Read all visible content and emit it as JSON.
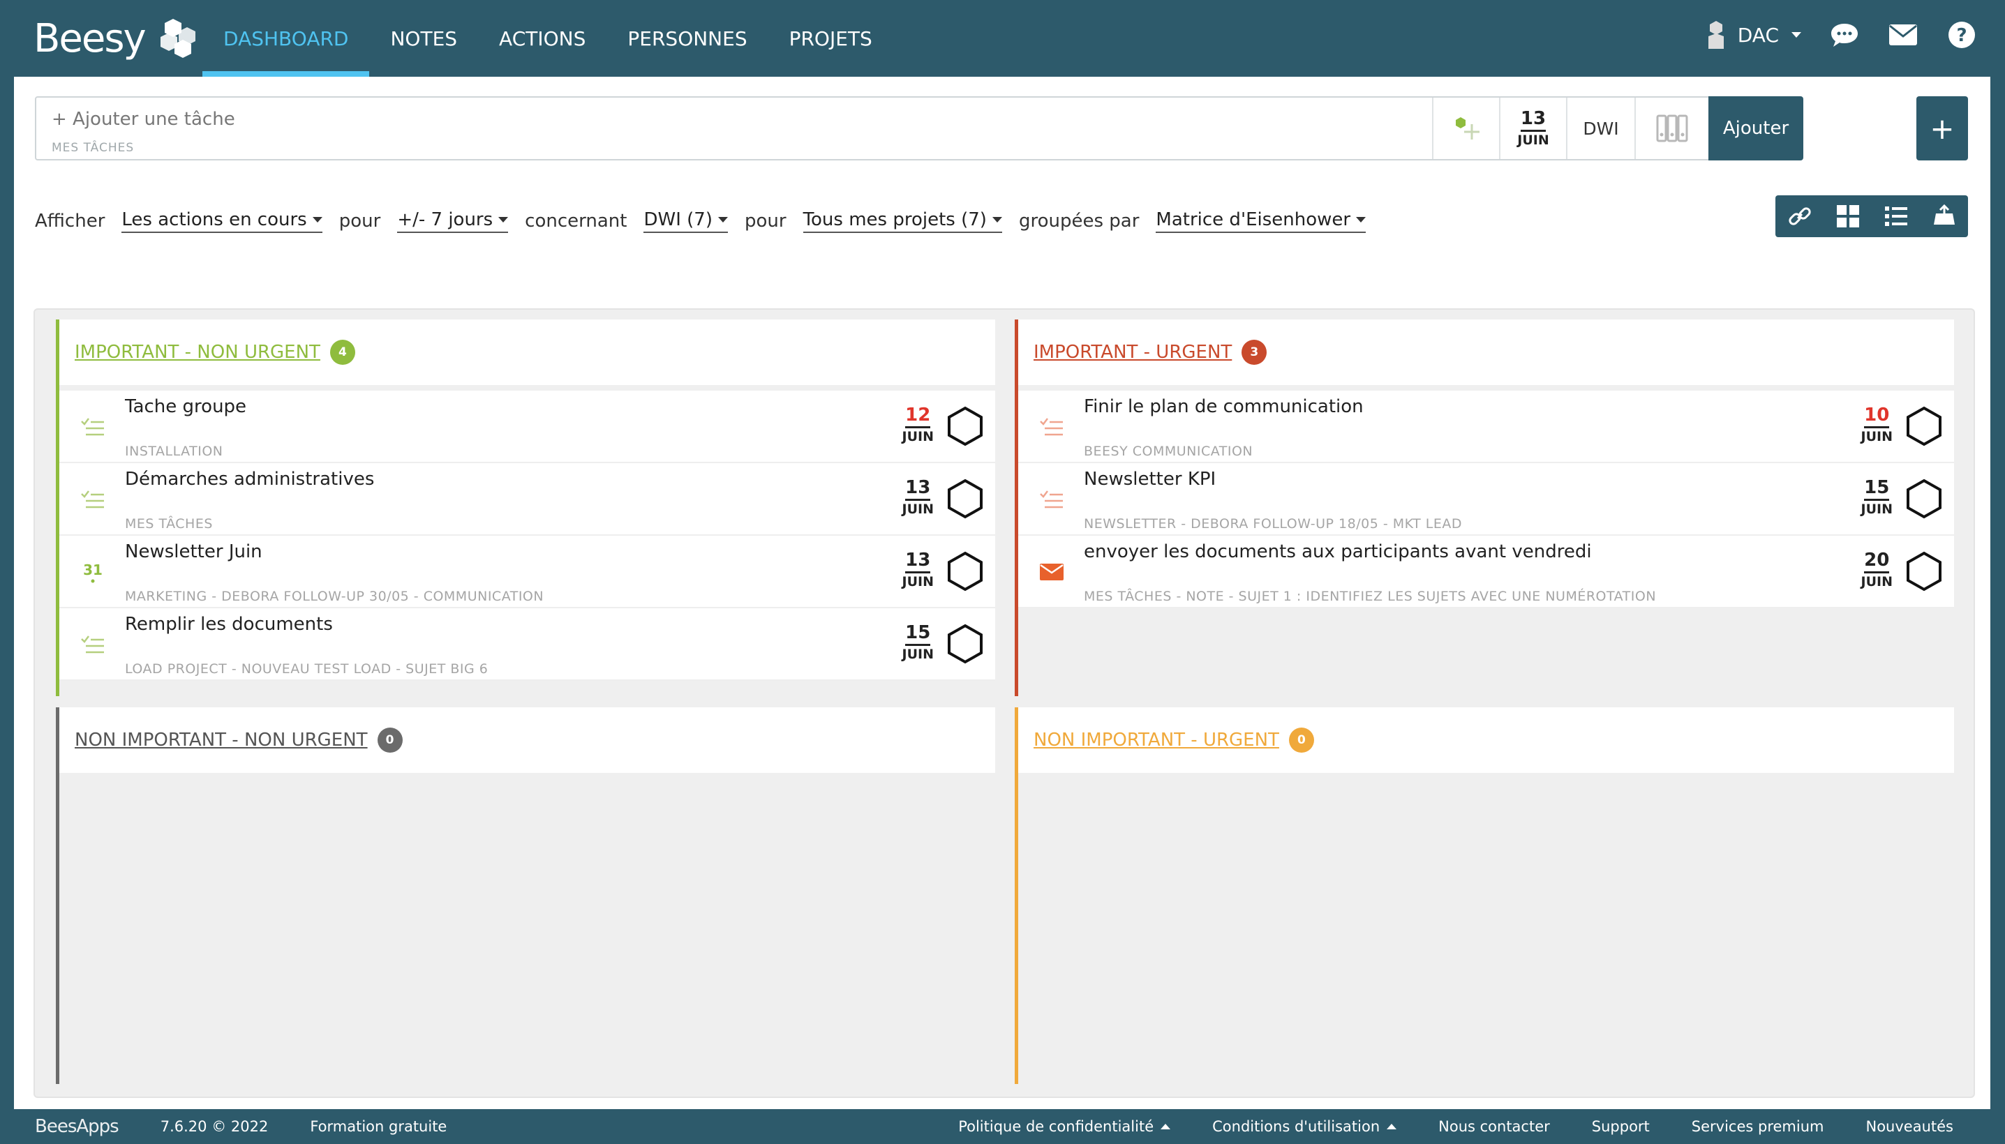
{
  "app": {
    "logo_text": "Beesy"
  },
  "nav": {
    "items": [
      {
        "label": "DASHBOARD"
      },
      {
        "label": "NOTES"
      },
      {
        "label": "ACTIONS"
      },
      {
        "label": "PERSONNES"
      },
      {
        "label": "PROJETS"
      }
    ],
    "active": "DASHBOARD"
  },
  "user": {
    "initials": "DAC"
  },
  "icons": {
    "chat": "chat-bubble-icon",
    "mail": "envelope-icon",
    "help": "help-circle-icon"
  },
  "add_task": {
    "placeholder": "+ Ajouter une tâche",
    "sublabel": "MES TÂCHES",
    "date_day": "13",
    "date_month": "JUIN",
    "owner": "DWI",
    "button": "Ajouter",
    "plus": "+"
  },
  "filters": {
    "show_label": "Afficher",
    "show_value": "Les actions en cours",
    "for_label": "pour",
    "period_value": "+/- 7 jours",
    "concerning_label": "concernant",
    "person_value": "DWI (7)",
    "for_label2": "pour",
    "projects_value": "Tous mes projets (7)",
    "grouped_label": "groupées par",
    "group_value": "Matrice d'Eisenhower"
  },
  "colors": {
    "brand": "#2d5a6b",
    "active_nav": "#4fc3f0",
    "important_non_urgent": "#8fbc3e",
    "important_urgent": "#c94a2c",
    "non_important_non_urgent": "#6b6b6b",
    "non_important_urgent": "#f0a93b",
    "overdue": "#e0352b"
  },
  "quadrants": {
    "q1": {
      "title": "IMPORTANT - NON URGENT",
      "count": "4",
      "tasks": [
        {
          "name": "Tache groupe",
          "project": "INSTALLATION",
          "day": "12",
          "month": "JUIN",
          "icon": "task-list-icon"
        },
        {
          "name": "Démarches administratives",
          "project": "MES TÂCHES",
          "day": "13",
          "month": "JUIN",
          "icon": "task-list-icon"
        },
        {
          "name": "Newsletter Juin",
          "project": "MARKETING - DEBORA FOLLOW-UP 30/05 - COMMUNICATION",
          "day": "13",
          "month": "JUIN",
          "icon": "calendar-icon",
          "icon_text": "31"
        },
        {
          "name": "Remplir les documents",
          "project": "LOAD PROJECT - NOUVEAU TEST LOAD - SUJET BIG 6",
          "day": "15",
          "month": "JUIN",
          "icon": "task-list-icon"
        }
      ]
    },
    "q2": {
      "title": "IMPORTANT - URGENT",
      "count": "3",
      "tasks": [
        {
          "name": "Finir le plan de communication",
          "project": "BEESY COMMUNICATION",
          "day": "10",
          "month": "JUIN",
          "icon": "task-list-icon"
        },
        {
          "name": "Newsletter KPI",
          "project": "NEWSLETTER - DEBORA FOLLOW-UP 18/05 - MKT LEAD",
          "day": "15",
          "month": "JUIN",
          "icon": "task-list-icon"
        },
        {
          "name": "envoyer les documents aux participants avant vendredi",
          "project": "MES TÂCHES - NOTE - SUJET 1 : IDENTIFIEZ LES SUJETS AVEC UNE NUMÉROTATION",
          "day": "20",
          "month": "JUIN",
          "icon": "envelope-icon"
        }
      ]
    },
    "q3": {
      "title": "NON IMPORTANT - NON URGENT",
      "count": "0"
    },
    "q4": {
      "title": "NON IMPORTANT - URGENT",
      "count": "0"
    }
  },
  "footer": {
    "logo": "BeesApps",
    "version": "7.6.20 © 2022",
    "training": "Formation gratuite",
    "privacy": "Politique de confidentialité",
    "terms": "Conditions d'utilisation",
    "contact": "Nous contacter",
    "support": "Support",
    "premium": "Services premium",
    "news": "Nouveautés"
  }
}
